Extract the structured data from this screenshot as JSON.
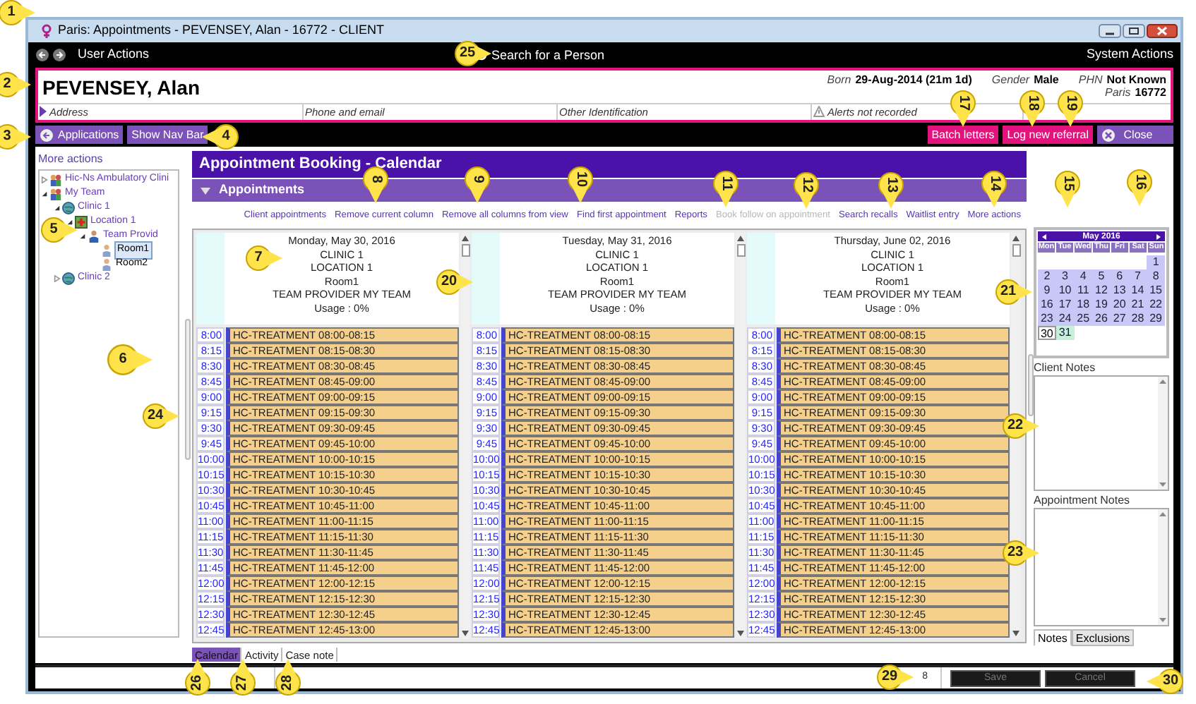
{
  "window": {
    "title": "Paris: Appointments - PEVENSEY, Alan - 16772 - CLIENT"
  },
  "nav_bar": {
    "left": "User Actions",
    "search": "Search for a Person",
    "right": "System Actions"
  },
  "patient": {
    "name": "PEVENSEY, Alan",
    "details": [
      {
        "label": "Born",
        "value": "29-Aug-2014 (21m 1d)"
      },
      {
        "label": "Gender",
        "value": "Male"
      },
      {
        "label": "PHN",
        "value": "Not Known"
      }
    ],
    "sub_detail": {
      "label": "Paris",
      "value": "16772"
    },
    "fields": [
      {
        "label": "Address",
        "kind": "expand"
      },
      {
        "label": "Phone and email",
        "kind": "plain"
      },
      {
        "label": "Other Identification",
        "kind": "plain"
      },
      {
        "label": "Alerts not recorded",
        "kind": "alert"
      }
    ]
  },
  "action_bar": {
    "left": [
      {
        "label": "Applications",
        "kind": "back"
      },
      {
        "label": "Show Nav Bar",
        "kind": "plain"
      }
    ],
    "right": [
      {
        "label": "Batch letters",
        "kind": "pink"
      },
      {
        "label": "Log new referral",
        "kind": "pink"
      },
      {
        "label": "Close",
        "kind": "close"
      }
    ]
  },
  "left_panel": {
    "more_actions": "More actions",
    "tree": [
      {
        "label": "Hic-Ns Ambulatory Clini",
        "kind": "team",
        "expanded": false,
        "selected": false
      },
      {
        "label": "My Team",
        "kind": "team",
        "expanded": true,
        "selected": false,
        "children": [
          {
            "label": "Clinic 1",
            "kind": "clinic",
            "expanded": true,
            "selected": false,
            "children": [
              {
                "label": "Location 1",
                "kind": "location",
                "expanded": true,
                "selected": false,
                "children": [
                  {
                    "label": "Team Provid",
                    "kind": "provider",
                    "expanded": true,
                    "selected": false,
                    "children": [
                      {
                        "label": "Room1",
                        "kind": "room",
                        "selected": true
                      },
                      {
                        "label": "Room2",
                        "kind": "room",
                        "selected": false
                      }
                    ]
                  }
                ]
              }
            ]
          },
          {
            "label": "Clinic 2",
            "kind": "clinic",
            "expanded": false,
            "selected": false
          }
        ]
      }
    ]
  },
  "booking": {
    "title": "Appointment Booking - Calendar",
    "section": "Appointments",
    "actions": [
      {
        "label": "Client appointments",
        "disabled": false
      },
      {
        "label": "Remove current column",
        "disabled": false
      },
      {
        "label": "Remove all columns from view",
        "disabled": false
      },
      {
        "label": "Find first appointment",
        "disabled": false
      },
      {
        "label": "Reports",
        "disabled": false
      },
      {
        "label": "Book follow on appointment",
        "disabled": true
      },
      {
        "label": "Search recalls",
        "disabled": false
      },
      {
        "label": "Waitlist entry",
        "disabled": false
      },
      {
        "label": "More actions",
        "disabled": false
      }
    ],
    "columns": [
      {
        "header": [
          "Monday, May 30, 2016",
          "CLINIC 1",
          "LOCATION 1",
          "Room1",
          "TEAM PROVIDER MY TEAM",
          "Usage : 0%"
        ],
        "slots": [
          {
            "time": "8:00",
            "label": "HC-TREATMENT 08:00-08:15"
          },
          {
            "time": "8:15",
            "label": "HC-TREATMENT 08:15-08:30"
          },
          {
            "time": "8:30",
            "label": "HC-TREATMENT 08:30-08:45"
          },
          {
            "time": "8:45",
            "label": "HC-TREATMENT 08:45-09:00"
          },
          {
            "time": "9:00",
            "label": "HC-TREATMENT 09:00-09:15"
          },
          {
            "time": "9:15",
            "label": "HC-TREATMENT 09:15-09:30"
          },
          {
            "time": "9:30",
            "label": "HC-TREATMENT 09:30-09:45"
          },
          {
            "time": "9:45",
            "label": "HC-TREATMENT 09:45-10:00"
          },
          {
            "time": "10:00",
            "label": "HC-TREATMENT 10:00-10:15"
          },
          {
            "time": "10:15",
            "label": "HC-TREATMENT 10:15-10:30"
          },
          {
            "time": "10:30",
            "label": "HC-TREATMENT 10:30-10:45"
          },
          {
            "time": "10:45",
            "label": "HC-TREATMENT 10:45-11:00"
          },
          {
            "time": "11:00",
            "label": "HC-TREATMENT 11:00-11:15"
          },
          {
            "time": "11:15",
            "label": "HC-TREATMENT 11:15-11:30"
          },
          {
            "time": "11:30",
            "label": "HC-TREATMENT 11:30-11:45"
          },
          {
            "time": "11:45",
            "label": "HC-TREATMENT 11:45-12:00"
          },
          {
            "time": "12:00",
            "label": "HC-TREATMENT 12:00-12:15"
          },
          {
            "time": "12:15",
            "label": "HC-TREATMENT 12:15-12:30"
          },
          {
            "time": "12:30",
            "label": "HC-TREATMENT 12:30-12:45"
          },
          {
            "time": "12:45",
            "label": "HC-TREATMENT 12:45-13:00"
          }
        ]
      },
      {
        "header": [
          "Tuesday, May 31, 2016",
          "CLINIC 1",
          "LOCATION 1",
          "Room1",
          "TEAM PROVIDER MY TEAM",
          "Usage : 0%"
        ],
        "slots": [
          {
            "time": "8:00",
            "label": "HC-TREATMENT 08:00-08:15"
          },
          {
            "time": "8:15",
            "label": "HC-TREATMENT 08:15-08:30"
          },
          {
            "time": "8:30",
            "label": "HC-TREATMENT 08:30-08:45"
          },
          {
            "time": "8:45",
            "label": "HC-TREATMENT 08:45-09:00"
          },
          {
            "time": "9:00",
            "label": "HC-TREATMENT 09:00-09:15"
          },
          {
            "time": "9:15",
            "label": "HC-TREATMENT 09:15-09:30"
          },
          {
            "time": "9:30",
            "label": "HC-TREATMENT 09:30-09:45"
          },
          {
            "time": "9:45",
            "label": "HC-TREATMENT 09:45-10:00"
          },
          {
            "time": "10:00",
            "label": "HC-TREATMENT 10:00-10:15"
          },
          {
            "time": "10:15",
            "label": "HC-TREATMENT 10:15-10:30"
          },
          {
            "time": "10:30",
            "label": "HC-TREATMENT 10:30-10:45"
          },
          {
            "time": "10:45",
            "label": "HC-TREATMENT 10:45-11:00"
          },
          {
            "time": "11:00",
            "label": "HC-TREATMENT 11:00-11:15"
          },
          {
            "time": "11:15",
            "label": "HC-TREATMENT 11:15-11:30"
          },
          {
            "time": "11:30",
            "label": "HC-TREATMENT 11:30-11:45"
          },
          {
            "time": "11:45",
            "label": "HC-TREATMENT 11:45-12:00"
          },
          {
            "time": "12:00",
            "label": "HC-TREATMENT 12:00-12:15"
          },
          {
            "time": "12:15",
            "label": "HC-TREATMENT 12:15-12:30"
          },
          {
            "time": "12:30",
            "label": "HC-TREATMENT 12:30-12:45"
          },
          {
            "time": "12:45",
            "label": "HC-TREATMENT 12:45-13:00"
          }
        ]
      },
      {
        "header": [
          "Thursday, June 02, 2016",
          "CLINIC 1",
          "LOCATION 1",
          "Room1",
          "TEAM PROVIDER MY TEAM",
          "Usage : 0%"
        ],
        "slots": [
          {
            "time": "8:00",
            "label": "HC-TREATMENT 08:00-08:15"
          },
          {
            "time": "8:15",
            "label": "HC-TREATMENT 08:15-08:30"
          },
          {
            "time": "8:30",
            "label": "HC-TREATMENT 08:30-08:45"
          },
          {
            "time": "8:45",
            "label": "HC-TREATMENT 08:45-09:00"
          },
          {
            "time": "9:00",
            "label": "HC-TREATMENT 09:00-09:15"
          },
          {
            "time": "9:15",
            "label": "HC-TREATMENT 09:15-09:30"
          },
          {
            "time": "9:30",
            "label": "HC-TREATMENT 09:30-09:45"
          },
          {
            "time": "9:45",
            "label": "HC-TREATMENT 09:45-10:00"
          },
          {
            "time": "10:00",
            "label": "HC-TREATMENT 10:00-10:15"
          },
          {
            "time": "10:15",
            "label": "HC-TREATMENT 10:15-10:30"
          },
          {
            "time": "10:30",
            "label": "HC-TREATMENT 10:30-10:45"
          },
          {
            "time": "10:45",
            "label": "HC-TREATMENT 10:45-11:00"
          },
          {
            "time": "11:00",
            "label": "HC-TREATMENT 11:00-11:15"
          },
          {
            "time": "11:15",
            "label": "HC-TREATMENT 11:15-11:30"
          },
          {
            "time": "11:30",
            "label": "HC-TREATMENT 11:30-11:45"
          },
          {
            "time": "11:45",
            "label": "HC-TREATMENT 11:45-12:00"
          },
          {
            "time": "12:00",
            "label": "HC-TREATMENT 12:00-12:15"
          },
          {
            "time": "12:15",
            "label": "HC-TREATMENT 12:15-12:30"
          },
          {
            "time": "12:30",
            "label": "HC-TREATMENT 12:30-12:45"
          },
          {
            "time": "12:45",
            "label": "HC-TREATMENT 12:45-13:00"
          }
        ]
      }
    ],
    "tabs": [
      {
        "label": "Calendar",
        "selected": true
      },
      {
        "label": "Activity",
        "selected": false
      },
      {
        "label": "Case note",
        "selected": false
      }
    ]
  },
  "mini_calendar": {
    "title": "May 2016",
    "weekdays": [
      "Mon",
      "Tue",
      "Wed",
      "Thu",
      "Fri",
      "Sat",
      "Sun"
    ],
    "weeks": [
      [
        {
          "label": "1",
          "kind": "range"
        }
      ],
      [
        {
          "label": "2",
          "kind": "range"
        },
        {
          "label": "3",
          "kind": "range"
        },
        {
          "label": "4",
          "kind": "range"
        },
        {
          "label": "5",
          "kind": "range"
        },
        {
          "label": "6",
          "kind": "range"
        },
        {
          "label": "7",
          "kind": "range"
        },
        {
          "label": "8",
          "kind": "range"
        }
      ],
      [
        {
          "label": "9",
          "kind": "range"
        },
        {
          "label": "10",
          "kind": "range"
        },
        {
          "label": "11",
          "kind": "range"
        },
        {
          "label": "12",
          "kind": "range"
        },
        {
          "label": "13",
          "kind": "range"
        },
        {
          "label": "14",
          "kind": "range"
        },
        {
          "label": "15",
          "kind": "range"
        }
      ],
      [
        {
          "label": "16",
          "kind": "range"
        },
        {
          "label": "17",
          "kind": "range"
        },
        {
          "label": "18",
          "kind": "range"
        },
        {
          "label": "19",
          "kind": "range"
        },
        {
          "label": "20",
          "kind": "range"
        },
        {
          "label": "21",
          "kind": "range"
        },
        {
          "label": "22",
          "kind": "range"
        }
      ],
      [
        {
          "label": "23",
          "kind": "range"
        },
        {
          "label": "24",
          "kind": "range"
        },
        {
          "label": "25",
          "kind": "range"
        },
        {
          "label": "26",
          "kind": "range"
        },
        {
          "label": "27",
          "kind": "range"
        },
        {
          "label": "28",
          "kind": "range"
        },
        {
          "label": "29",
          "kind": "range"
        }
      ],
      [
        {
          "label": "30",
          "kind": "selected"
        },
        {
          "label": "31",
          "kind": "today"
        }
      ]
    ]
  },
  "right_panel": {
    "client_notes": "Client Notes",
    "appointment_notes": "Appointment Notes",
    "tabs": [
      {
        "label": "Notes",
        "selected": true
      },
      {
        "label": "Exclusions",
        "selected": false
      }
    ]
  },
  "footer": {
    "count": "8",
    "buttons": [
      {
        "label": "Save",
        "disabled": true
      },
      {
        "label": "Cancel",
        "disabled": true
      }
    ]
  },
  "callouts": [
    {
      "label": "1"
    },
    {
      "label": "2"
    },
    {
      "label": "3"
    },
    {
      "label": "4"
    },
    {
      "label": "5"
    },
    {
      "label": "6"
    },
    {
      "label": "7"
    },
    {
      "label": "8"
    },
    {
      "label": "9"
    },
    {
      "label": "10"
    },
    {
      "label": "11"
    },
    {
      "label": "12"
    },
    {
      "label": "13"
    },
    {
      "label": "14"
    },
    {
      "label": "15"
    },
    {
      "label": "16"
    },
    {
      "label": "17"
    },
    {
      "label": "18"
    },
    {
      "label": "19"
    },
    {
      "label": "20"
    },
    {
      "label": "21"
    },
    {
      "label": "22"
    },
    {
      "label": "23"
    },
    {
      "label": "24"
    },
    {
      "label": "25"
    },
    {
      "label": "26"
    },
    {
      "label": "27"
    },
    {
      "label": "28"
    },
    {
      "label": "29"
    },
    {
      "label": "30"
    }
  ]
}
